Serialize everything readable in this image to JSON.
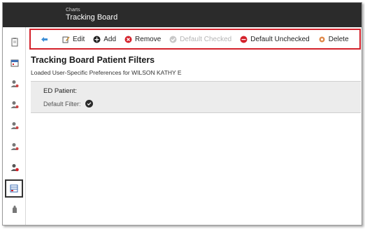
{
  "header": {
    "breadcrumb": "Charts",
    "title": "Tracking Board"
  },
  "sidebar": {
    "items": [
      {
        "icon": "clipboard-icon"
      },
      {
        "icon": "calendar-icon"
      },
      {
        "icon": "person-icon"
      },
      {
        "icon": "person-icon"
      },
      {
        "icon": "person-icon"
      },
      {
        "icon": "person-icon"
      },
      {
        "icon": "person-alert-icon"
      },
      {
        "icon": "tracking-board-icon",
        "active": true
      },
      {
        "icon": "hand-icon"
      }
    ]
  },
  "toolbar": {
    "back_icon": "back-arrow-icon",
    "edit_label": "Edit",
    "add_label": "Add",
    "remove_label": "Remove",
    "default_checked_label": "Default Checked",
    "default_unchecked_label": "Default Unchecked",
    "delete_label": "Delete"
  },
  "main": {
    "title": "Tracking Board Patient Filters",
    "subtitle": "Loaded User-Specific Preferences for WILSON KATHY E",
    "filter": {
      "name": "ED Patient:",
      "default_label": "Default Filter:"
    }
  },
  "colors": {
    "header_bg": "#2b2b2b",
    "toolbar_border": "#d4202a",
    "remove_red": "#d4202a",
    "add_dark": "#222222",
    "disabled_gray": "#b5b5b5",
    "back_blue": "#3d8fd6"
  }
}
